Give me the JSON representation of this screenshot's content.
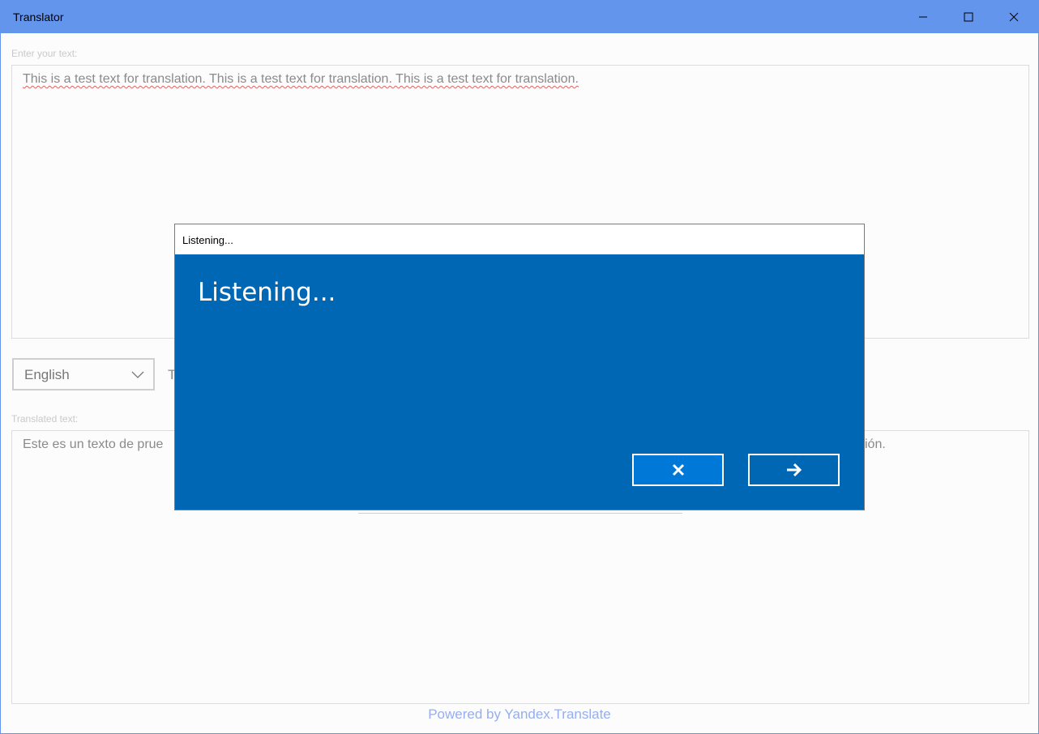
{
  "window": {
    "title": "Translator",
    "accent_color": "#6495ed",
    "controls": [
      "minimize-icon",
      "maximize-icon",
      "close-icon"
    ]
  },
  "input": {
    "label": "Enter your text:",
    "value": "This is a test text for translation. This is a test text for translation. This is a test text for translation."
  },
  "language": {
    "selected": "English",
    "partial_label": "T"
  },
  "output": {
    "label": "Translated text:",
    "value_left": "Este es un texto de prue",
    "value_right": "ión."
  },
  "footer": {
    "text": "Powered by Yandex.Translate"
  },
  "dialog": {
    "title": "Listening...",
    "heading": "Listening...",
    "background_color": "#0067b4",
    "buttons": {
      "cancel_icon": "close-icon",
      "continue_icon": "arrow-right-icon"
    }
  }
}
